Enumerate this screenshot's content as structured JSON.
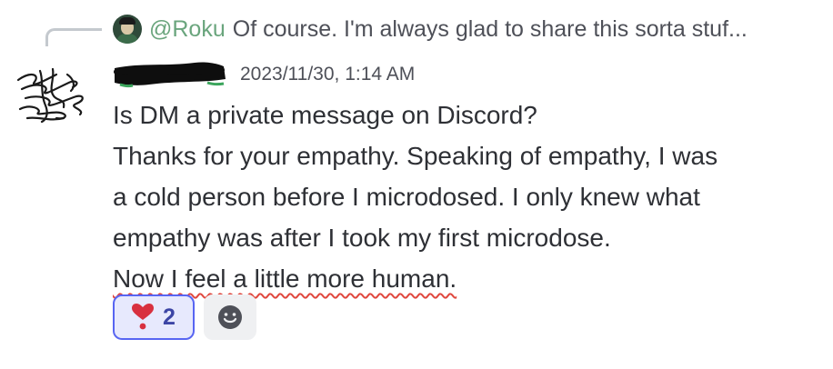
{
  "reply": {
    "author": "@Roku",
    "preview": "Of course. I'm always glad to share this sorta stuf..."
  },
  "message": {
    "author": "",
    "timestamp": "2023/11/30, 1:14 AM",
    "lines": [
      "Is DM a private message on Discord?",
      "Thanks for your empathy. Speaking of empathy, I was",
      "a cold person before I microdosed. I only knew what",
      "empathy was after I took my first microdose.",
      "Now I feel a little more human."
    ]
  },
  "reactions": [
    {
      "emoji": "❣",
      "count": "2",
      "icon": "heart-exclamation-icon"
    }
  ],
  "add_reaction_icon": "smiley-icon",
  "colors": {
    "reply_author": "#6aa57d",
    "username": "#3ba55c",
    "reaction_border": "#5865f2",
    "reaction_bg": "#e7e9fd",
    "heart": "#d8303f"
  }
}
